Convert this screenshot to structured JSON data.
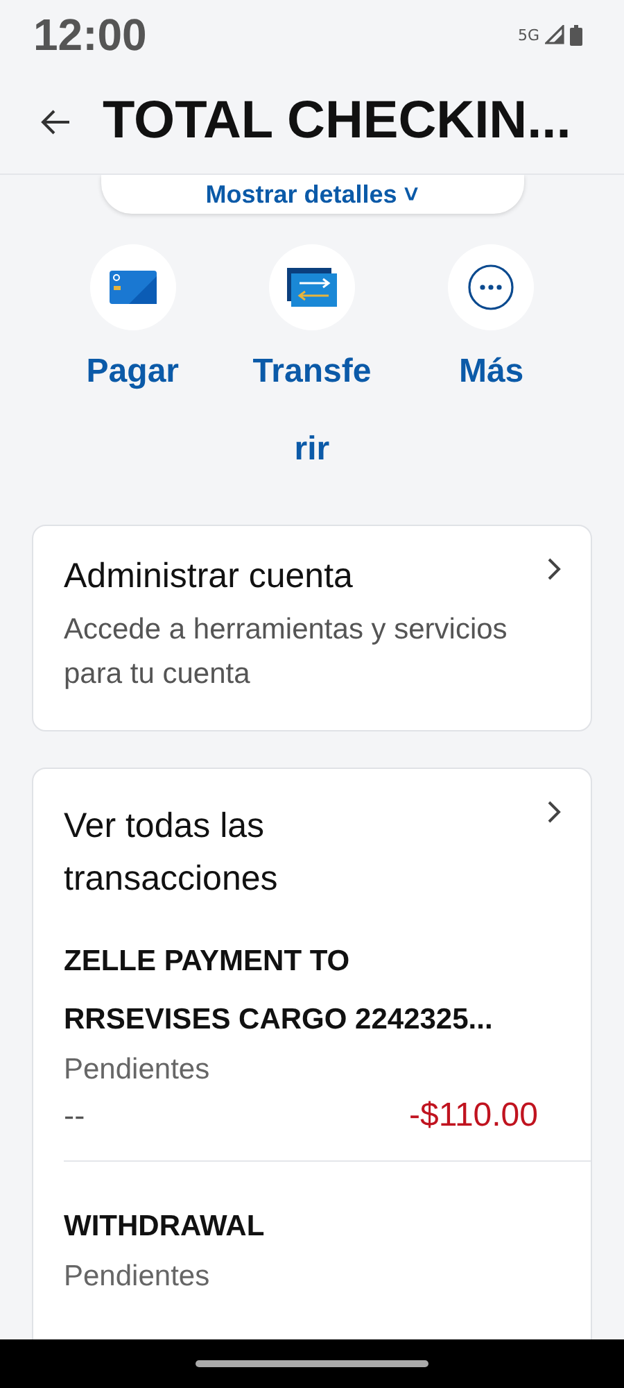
{
  "status_bar": {
    "time": "12:00",
    "network": "5G"
  },
  "header": {
    "title": "TOTAL CHECKIN..."
  },
  "details_button": {
    "label": "Mostrar detalles ˅"
  },
  "actions": [
    {
      "kind": "pay",
      "label": "Pagar"
    },
    {
      "kind": "transfer",
      "label": "Transferir"
    },
    {
      "kind": "more",
      "label": "Más"
    }
  ],
  "manage_card": {
    "title": "Administrar cuenta",
    "description": "Accede a herramientas y servicios para tu cuenta"
  },
  "transactions": {
    "title": "Ver todas las transacciones",
    "items": [
      {
        "description": [
          "ZELLE PAYMENT TO",
          "RRSEVISES CARGO 2242325..."
        ],
        "status": "Pendientes",
        "date": "--",
        "amount": "-$110.00",
        "negative": true
      },
      {
        "description": [
          "WITHDRAWAL"
        ],
        "status": "Pendientes"
      }
    ]
  }
}
